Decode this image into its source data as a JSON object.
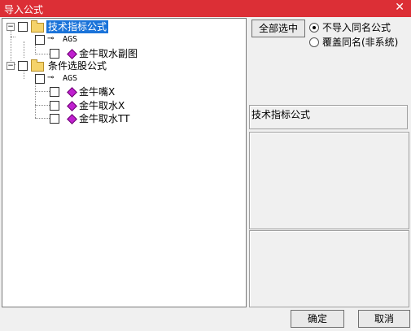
{
  "window": {
    "title": "导入公式",
    "close_glyph": "✕"
  },
  "tree": {
    "root1": {
      "label": "技术指标公式",
      "expander": "−"
    },
    "ags1": {
      "label": "AGS",
      "expander": "−"
    },
    "r1c1": {
      "label": "金牛取水副图"
    },
    "root2": {
      "label": "条件选股公式",
      "expander": "−"
    },
    "ags2": {
      "label": "AGS",
      "expander": "−"
    },
    "r2c1": {
      "label": "金牛嘴X"
    },
    "r2c2": {
      "label": "金牛取水X"
    },
    "r2c3": {
      "label": "金牛取水TT"
    }
  },
  "options": {
    "select_all_label": "全部选中",
    "radio_skip": {
      "label": "不导入同名公式",
      "checked": true
    },
    "radio_overwrite": {
      "label": "覆盖同名(非系统)",
      "checked": false
    }
  },
  "info_panel": {
    "title": "技术指标公式"
  },
  "buttons": {
    "ok": "确定",
    "cancel": "取消"
  },
  "colors": {
    "titlebar": "#dc2f36",
    "selection": "#1a73d9",
    "formula_icon": "#c020d0"
  }
}
